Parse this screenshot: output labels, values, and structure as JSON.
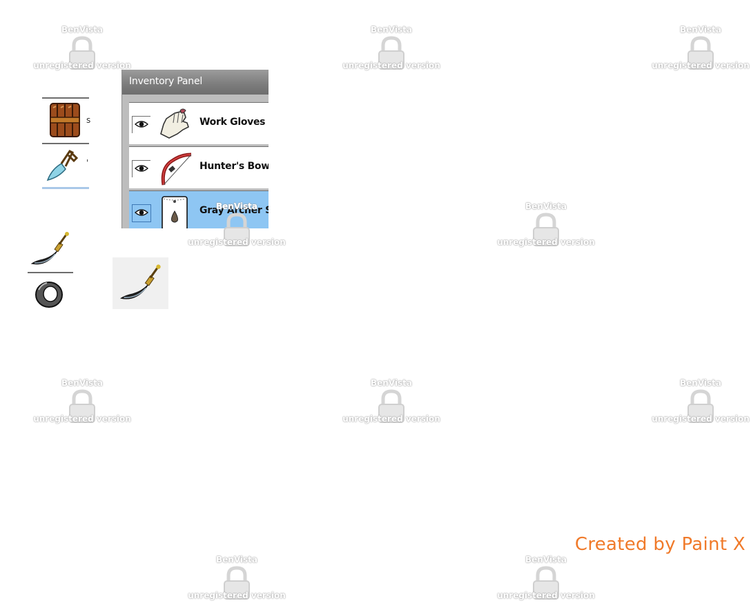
{
  "watermark": {
    "brand": "BenVista",
    "text": "unregistered version"
  },
  "inventory_panel": {
    "title": "Inventory Panel",
    "rows": [
      {
        "label": "Work Gloves",
        "icon": "gloves-icon",
        "visible": true,
        "selected": false
      },
      {
        "label": "Hunter's Bow",
        "icon": "bow-icon",
        "visible": true,
        "selected": false
      },
      {
        "label": "Gray Archer S",
        "icon": "scroll-icon",
        "visible": true,
        "selected": true
      }
    ]
  },
  "mini_strip": {
    "items": [
      {
        "icon": "leather-armor-icon",
        "label_glyph": "s"
      },
      {
        "icon": "crystal-dagger-icon",
        "label_glyph": "'"
      }
    ]
  },
  "lower_icons": [
    "curved-dagger-icon",
    "ring-icon",
    "curved-dagger-tile-icon"
  ],
  "footer": {
    "credit": "Created by Paint X",
    "credit_color": "#f07a2a"
  },
  "colors": {
    "selected_row": "#8ec6f3",
    "title_bar": "#7c7c7c"
  }
}
